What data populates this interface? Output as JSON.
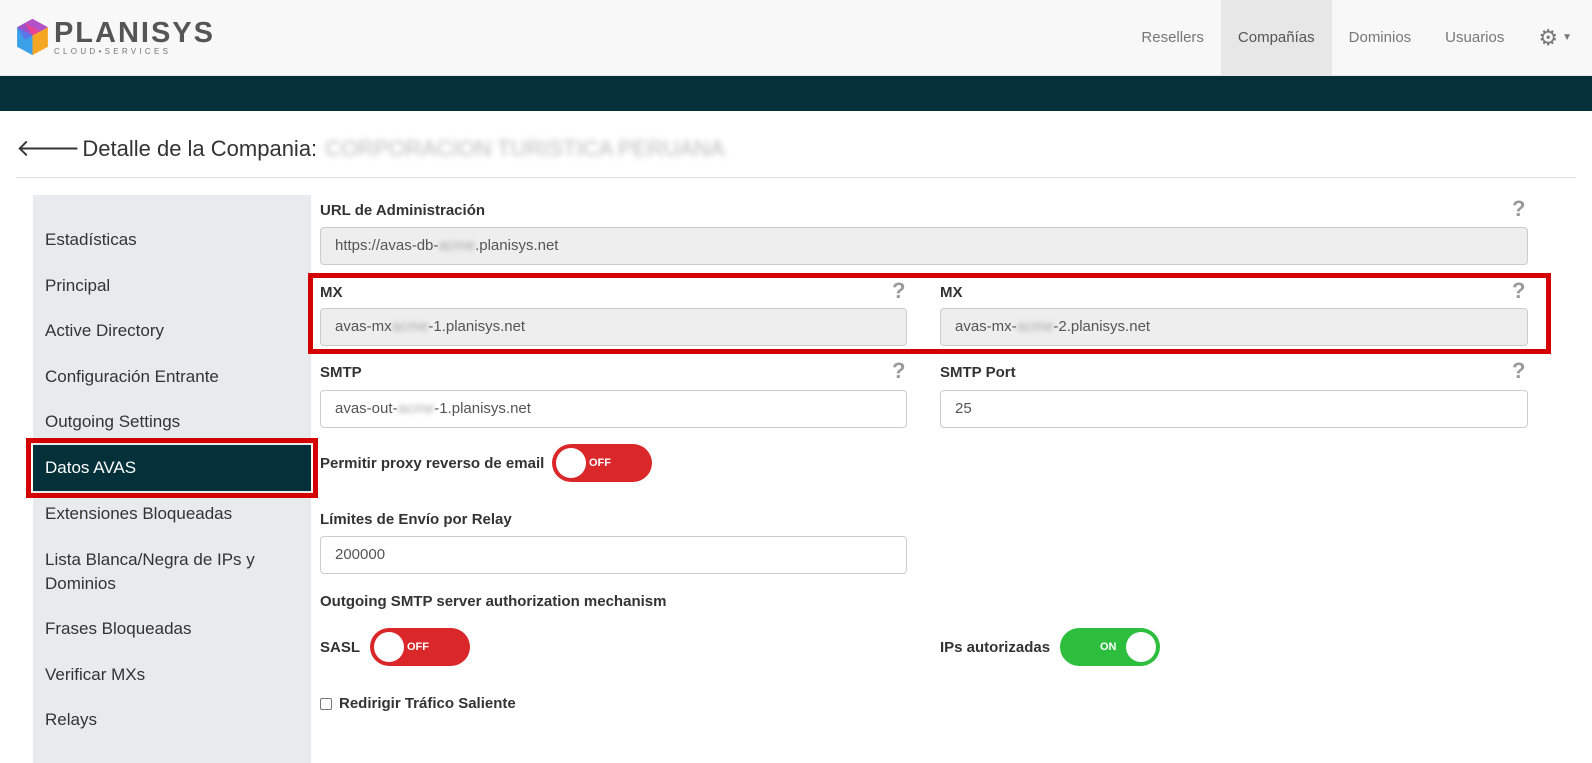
{
  "brand": {
    "name": "PLANISYS",
    "tagline": "CLOUD•SERVICES"
  },
  "nav": {
    "items": [
      {
        "label": "Resellers",
        "active": false
      },
      {
        "label": "Compañías",
        "active": true
      },
      {
        "label": "Dominios",
        "active": false
      },
      {
        "label": "Usuarios",
        "active": false
      }
    ],
    "settings_icon": "gear-icon"
  },
  "header": {
    "title": "Detalle de la Compania:",
    "company": "CORPORACION TURISTICA PERUANA"
  },
  "sidebar": {
    "items": [
      {
        "label": "Estadísticas"
      },
      {
        "label": "Principal"
      },
      {
        "label": "Active Directory"
      },
      {
        "label": "Configuración Entrante"
      },
      {
        "label": "Outgoing Settings"
      },
      {
        "label": "Datos AVAS",
        "active": true
      },
      {
        "label": "Extensiones Bloqueadas"
      },
      {
        "label": "Lista Blanca/Negra de IPs y"
      },
      {
        "label": "Dominios"
      },
      {
        "label": "Frases Bloqueadas"
      },
      {
        "label": "Verificar MXs"
      },
      {
        "label": "Relays"
      }
    ]
  },
  "form": {
    "admin_url": {
      "label": "URL de Administración",
      "prefix": "https://avas-db-",
      "masked": "acme",
      "suffix": ".planisys.net"
    },
    "mx1": {
      "label": "MX",
      "prefix": "avas-mx",
      "masked": "acme",
      "suffix": "-1.planisys.net"
    },
    "mx2": {
      "label": "MX",
      "prefix": "avas-mx-",
      "masked": "acme",
      "suffix": "-2.planisys.net"
    },
    "smtp": {
      "label": "SMTP",
      "prefix": "avas-out-",
      "masked": "acme",
      "suffix": "-1.planisys.net"
    },
    "smtp_port": {
      "label": "SMTP Port",
      "value": "25"
    },
    "reverse_proxy": {
      "label": "Permitir proxy reverso de email",
      "state": "OFF"
    },
    "relay_limits": {
      "label": "Límites de Envío por Relay",
      "value": "200000"
    },
    "auth_mechanism": {
      "label": "Outgoing SMTP server authorization mechanism"
    },
    "sasl": {
      "label": "SASL",
      "state": "OFF"
    },
    "authorized_ips": {
      "label": "IPs autorizadas",
      "state": "ON"
    },
    "redirect": {
      "label": "Redirigir Tráfico Saliente",
      "checked": false
    },
    "help_glyph": "?"
  }
}
